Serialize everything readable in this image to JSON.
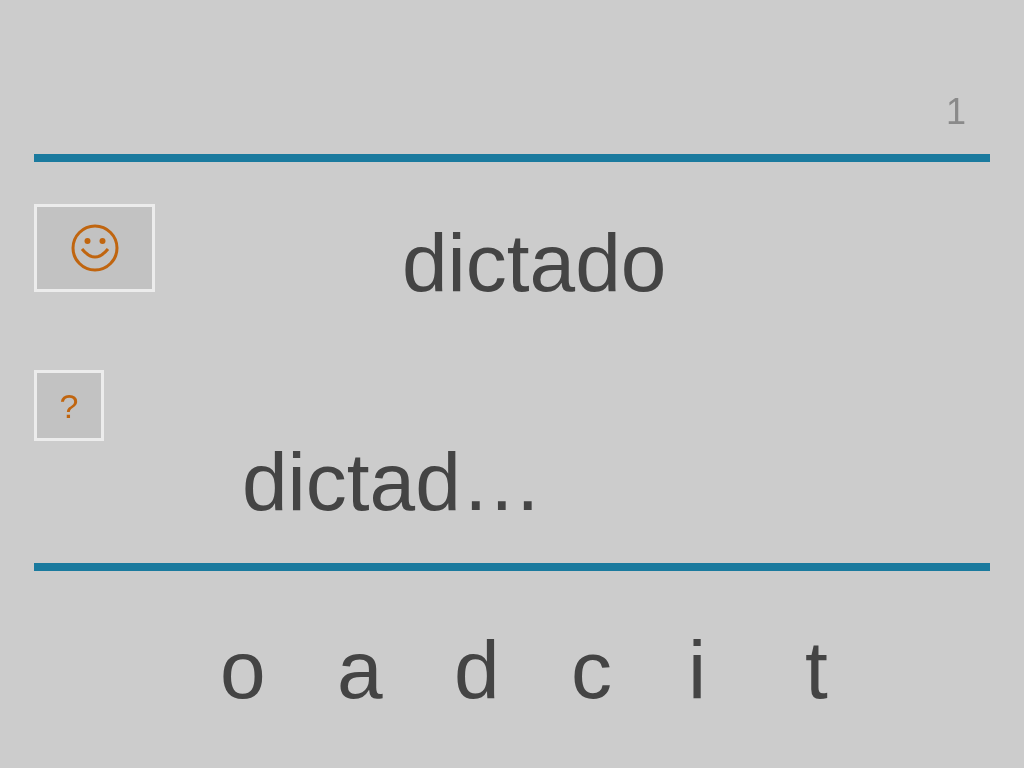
{
  "page_number": "1",
  "hint_button": {
    "kind": "smiley"
  },
  "help_button": {
    "label": "?"
  },
  "word": "dictado",
  "answer": "dictad…",
  "letters": [
    "o",
    "a",
    "d",
    "c",
    "i",
    "t"
  ]
}
